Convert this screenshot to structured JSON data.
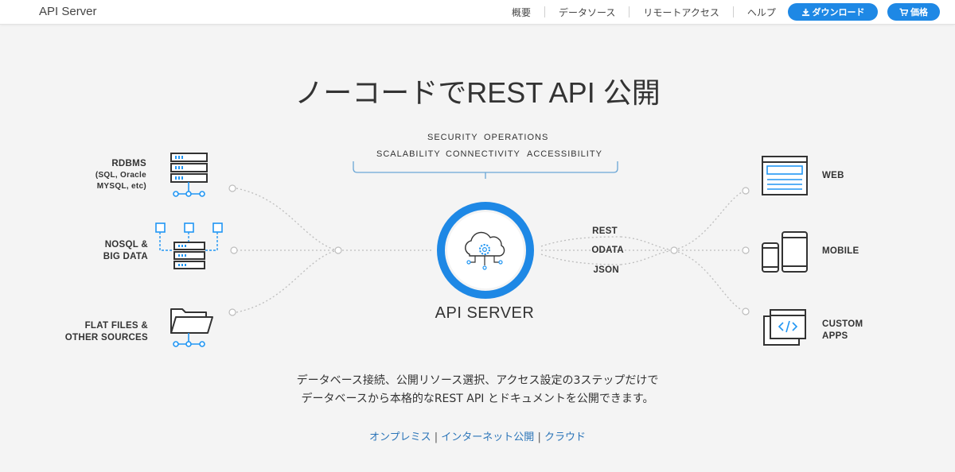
{
  "header": {
    "brand": "API Server",
    "nav": [
      "概要",
      "データソース",
      "リモートアクセス",
      "ヘルプ"
    ],
    "download_label": "ダウンロード",
    "price_label": "価格"
  },
  "hero": {
    "title": "ノーコードでREST API 公開"
  },
  "diagram": {
    "features_row1": [
      "SECURITY",
      "OPERATIONS"
    ],
    "features_row2": [
      "SCALABILITY",
      "CONNECTIVITY",
      "ACCESSIBILITY"
    ],
    "sources": {
      "rdbms": "RDBMS",
      "rdbms_sub1": "(SQL, Oracle",
      "rdbms_sub2": "MYSQL, etc)",
      "nosql1": "NOSQL &",
      "nosql2": "BIG DATA",
      "flat1": "FLAT FILES &",
      "flat2": "OTHER SOURCES"
    },
    "protocols": [
      "REST",
      "ODATA",
      "JSON"
    ],
    "targets": {
      "web": "WEB",
      "mobile": "MOBILE",
      "custom1": "CUSTOM",
      "custom2": "APPS"
    },
    "center_label": "API SERVER",
    "colors": {
      "accent": "#1e88e5",
      "icon_dark": "#333333",
      "icon_blue": "#2196f3"
    }
  },
  "description": {
    "line1": "データベース接続、公開リソース選択、アクセス設定の3ステップだけで",
    "line2": "データベースから本格的なREST API とドキュメントを公開できます。"
  },
  "links": {
    "onprem": "オンプレミス",
    "sep": "|",
    "internet": "インターネット公開",
    "cloud": "クラウド"
  }
}
